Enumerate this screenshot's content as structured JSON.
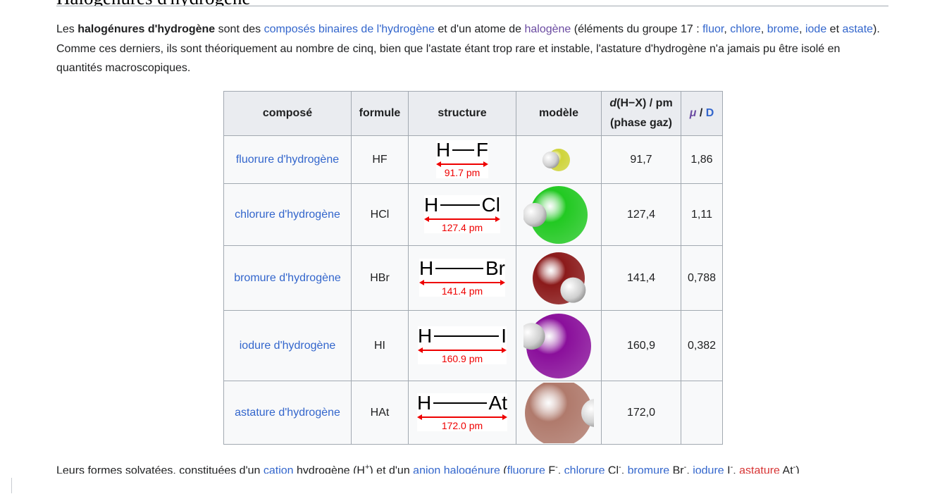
{
  "heading": "Halogénures d'hydrogène",
  "intro": {
    "t1": "Les ",
    "bold": "halogénures d'hydrogène",
    "t2": " sont des ",
    "link1": "composés binaires de l'hydrogène",
    "t3": " et d'un atome de ",
    "link2": "halogène",
    "t4": " (éléments du groupe 17 : ",
    "link3": "fluor",
    "sep1": ", ",
    "link4": "chlore",
    "sep2": ", ",
    "link5": "brome",
    "sep3": ", ",
    "link6": "iode",
    "t5": " et ",
    "link7": "astate",
    "t6": "). Comme ces derniers, ils sont théoriquement au nombre de cinq, bien que l'astate étant trop rare et instable, l'astature d'hydrogène n'a jamais pu être isolé en quantités macroscopiques."
  },
  "table": {
    "headers": {
      "compose": "composé",
      "formule": "formule",
      "structure": "structure",
      "modele": "modèle",
      "d_var": "d",
      "d_rest": "(H−X) / pm",
      "d_line2": "(phase gaz)",
      "mu_var": "μ",
      "mu_sep": " / ",
      "mu_unit": "D"
    },
    "rows": [
      {
        "name": "fluorure d'hydrogène",
        "formula": "HF",
        "h": "H",
        "x": "F",
        "len": "91.7 pm",
        "d": "91,7",
        "mu": "1,86",
        "color": "#cfd43a"
      },
      {
        "name": "chlorure d'hydrogène",
        "formula": "HCl",
        "h": "H",
        "x": "Cl",
        "len": "127.4 pm",
        "d": "127,4",
        "mu": "1,11",
        "color": "#22c922"
      },
      {
        "name": "bromure d'hydrogène",
        "formula": "HBr",
        "h": "H",
        "x": "Br",
        "len": "141.4 pm",
        "d": "141,4",
        "mu": "0,788",
        "color": "#8b1a1a"
      },
      {
        "name": "iodure d'hydrogène",
        "formula": "HI",
        "h": "H",
        "x": "I",
        "len": "160.9 pm",
        "d": "160,9",
        "mu": "0,382",
        "color": "#8a0f9b"
      },
      {
        "name": "astature d'hydrogène",
        "formula": "HAt",
        "h": "H",
        "x": "At",
        "len": "172.0 pm",
        "d": "172,0",
        "mu": "",
        "color": "#b07a6c"
      }
    ]
  },
  "footer": {
    "t1": "Leurs formes solvatées, constituées d'un ",
    "link1": "cation",
    "t2": " hydrogène (H",
    "sup1": "+",
    "t3": ") et d'un ",
    "link2": "anion",
    "t4": " ",
    "link3": "halogénure",
    "t5": " (",
    "link4": "fluorure",
    "t6": " F",
    "sup2": "-",
    "t7": ", ",
    "link5": "chlorure",
    "t8": " Cl",
    "sup3": "-",
    "t9": ", ",
    "link6": "bromure",
    "t10": " Br",
    "sup4": "-",
    "t11": ", ",
    "link7": "iodure",
    "t12": " I",
    "sup5": "-",
    "t13": ", ",
    "link8": "astature",
    "t14": " At",
    "sup6": "-",
    "t15": ")"
  }
}
